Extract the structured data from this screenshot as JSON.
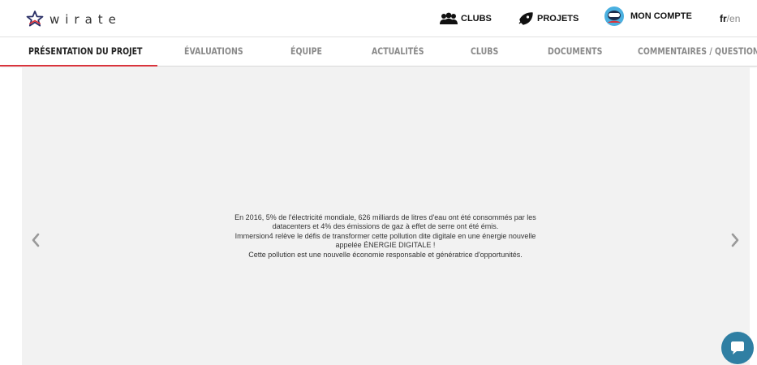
{
  "brand": {
    "logo_text": "wirate"
  },
  "topnav": {
    "clubs": "CLUBS",
    "projets": "PROJETS",
    "compte": "MON COMPTE"
  },
  "lang": {
    "current": "fr",
    "separator": "/",
    "other": "en"
  },
  "tabs": [
    {
      "label": "PRÉSENTATION DU PROJET",
      "active": true
    },
    {
      "label": "ÉVALUATIONS"
    },
    {
      "label": "ÉQUIPE"
    },
    {
      "label": "ACTUALITÉS"
    },
    {
      "label": "CLUBS"
    },
    {
      "label": "DOCUMENTS"
    },
    {
      "label": "COMMENTAIRES / QUESTIONS"
    }
  ],
  "slide": {
    "lines": [
      "En 2016, 5% de l'électricité mondiale, 626 milliards de litres d'eau ont été consommés par les",
      "datacenters et 4% des émissions de gaz à effet de serre ont été émis.",
      "Immersion4 relève le défis de transformer cette pollution dite digitale en une énergie nouvelle",
      "appelée ÉNERGIE DIGITALE !",
      "Cette pollution est une nouvelle économie responsable et génératrice d'opportunités."
    ]
  },
  "colors": {
    "accent": "#d9343c",
    "chat": "#2f7fa3",
    "carousel_bg": "#f2f2f2"
  },
  "icons": [
    "star-logo-icon",
    "clubs-icon",
    "projets-icon",
    "avatar-icon",
    "chevron-left-icon",
    "chevron-right-icon",
    "chat-icon"
  ]
}
